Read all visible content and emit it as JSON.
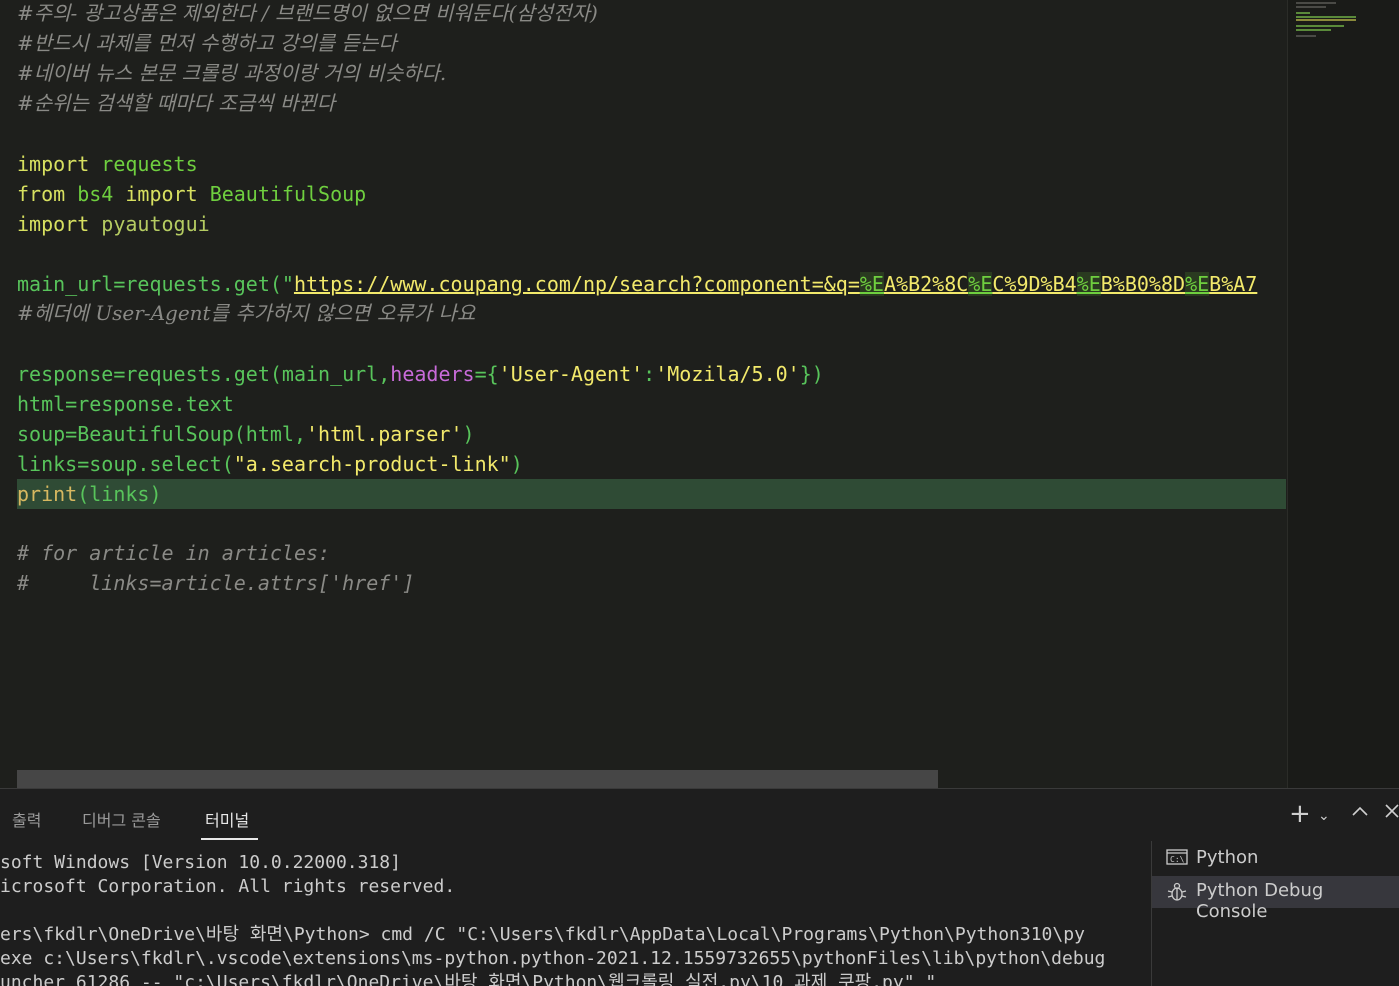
{
  "editor": {
    "lines": {
      "c1": "#주의- 광고상품은 제외한다 / 브랜드명이 없으면 비워둔다(삼성전자)",
      "c2": "#반드시 과제를 먼저 수행하고 강의를 듣는다",
      "c3": "#네이버 뉴스 본문 크롤링 과정이랑 거의 비슷하다.",
      "c4": "#순위는 검색할 때마다 조금씩 바뀐다",
      "import1_kw": "import",
      "import1_mod": "requests",
      "from_kw": "from",
      "from_mod": "bs4",
      "import2_kw": "import",
      "import2_name": "BeautifulSoup",
      "import3_kw": "import",
      "import3_mod": "pyautogui",
      "main_url_prefix": "main_url=requests.get(\"",
      "url_parts": [
        "https://www.coupang.com/np/search?component=&q=",
        "%E",
        "A%B2%8C",
        "%E",
        "C%9D%B4",
        "%E",
        "B%B0%8D",
        "%E",
        "B%A7"
      ],
      "c5": "#헤더에 User-Agent를 추가하지 않으면 오류가 나요",
      "response_prefix": "response=requests.get(main_url,",
      "response_param": "headers",
      "response_eq": "={",
      "response_key": "'User-Agent'",
      "response_colon": ":",
      "response_val": "'Mozila/5.0'",
      "response_suffix": "})",
      "html_line": "html=response.text",
      "soup_prefix": "soup=BeautifulSoup(html,",
      "soup_str": "'html.parser'",
      "soup_suffix": ")",
      "links_prefix": "links=soup.select(",
      "links_str": "\"a.search-product-link\"",
      "links_suffix": ")",
      "print_kw": "print",
      "print_args": "(links)",
      "c6": "# for article in articles:",
      "c7": "#     links=article.attrs['href']"
    }
  },
  "panel": {
    "tabs": [
      "출력",
      "디버그 콘솔",
      "터미널"
    ],
    "active_tab": "터미널",
    "terminal_lines": [
      "soft Windows [Version 10.0.22000.318]",
      "icrosoft Corporation. All rights reserved.",
      "",
      "ers\\fkdlr\\OneDrive\\바탕 화면\\Python> cmd /C \"C:\\Users\\fkdlr\\AppData\\Local\\Programs\\Python\\Python310\\py",
      "exe c:\\Users\\fkdlr\\.vscode\\extensions\\ms-python.python-2021.12.1559732655\\pythonFiles\\lib\\python\\debug",
      "uncher 61286 -- \"c:\\Users\\fkdlr\\OneDrive\\바탕 화면\\Python\\웹크롤링 실전.py\\10_과제_쿠팡.py\" \""
    ],
    "terminals": [
      {
        "label": "Python",
        "icon": "terminal-icon",
        "selected": false
      },
      {
        "label": "Python Debug Console",
        "icon": "debug-icon",
        "selected": true
      }
    ],
    "icons": {
      "add": "plus-icon",
      "dropdown": "chevron-down-icon",
      "maximize": "chevron-up-icon",
      "close": "close-icon"
    }
  }
}
